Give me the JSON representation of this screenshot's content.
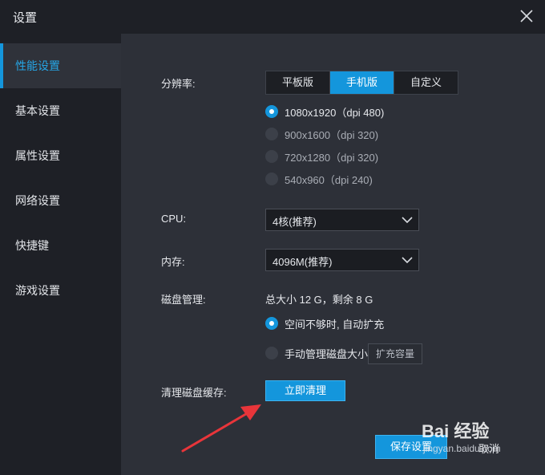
{
  "window": {
    "title": "设置",
    "close_icon": "close-icon"
  },
  "sidebar": {
    "items": [
      {
        "label": "性能设置",
        "active": true
      },
      {
        "label": "基本设置",
        "active": false
      },
      {
        "label": "属性设置",
        "active": false
      },
      {
        "label": "网络设置",
        "active": false
      },
      {
        "label": "快捷键",
        "active": false
      },
      {
        "label": "游戏设置",
        "active": false
      }
    ]
  },
  "resolution": {
    "label": "分辨率:",
    "modes": [
      "平板版",
      "手机版",
      "自定义"
    ],
    "selected_mode": "手机版",
    "options": [
      {
        "label": "1080x1920（dpi 480)",
        "selected": true
      },
      {
        "label": "900x1600（dpi 320)",
        "selected": false
      },
      {
        "label": "720x1280（dpi 320)",
        "selected": false
      },
      {
        "label": "540x960（dpi 240)",
        "selected": false
      }
    ]
  },
  "cpu": {
    "label": "CPU:",
    "value": "4核(推荐)"
  },
  "memory": {
    "label": "内存:",
    "value": "4096M(推荐)"
  },
  "disk": {
    "label": "磁盘管理:",
    "info": "总大小 12 G，剩余 8 G",
    "option_auto": "空间不够时, 自动扩充",
    "option_manual": "手动管理磁盘大小",
    "expand_button": "扩充容量",
    "selected": "auto"
  },
  "cache": {
    "label": "清理磁盘缓存:",
    "button": "立即清理"
  },
  "footer": {
    "save_button": "保存设置",
    "cancel_button": "取消"
  },
  "watermark": {
    "logo": "Bai 经验",
    "sub": "jingyan.baidu.com"
  },
  "colors": {
    "accent": "#1496dc",
    "arrow": "#e8353a"
  }
}
